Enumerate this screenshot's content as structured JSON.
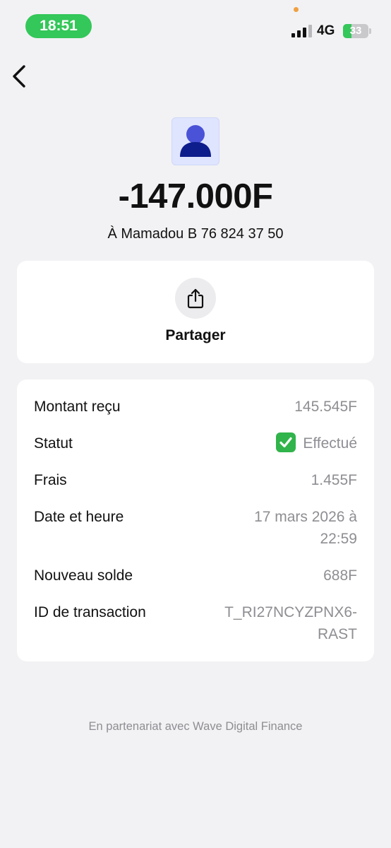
{
  "status_bar": {
    "time": "18:51",
    "network": "4G",
    "battery": "33",
    "battery_level": 0.33,
    "accent": "#34c759"
  },
  "icons": {
    "back": "chevron-left-icon",
    "avatar": "person-icon",
    "share": "share-icon",
    "status": "checkmark-icon"
  },
  "transaction": {
    "amount": "-147.000F",
    "recipient": "À Mamadou B 76 824 37 50"
  },
  "share": {
    "label": "Partager"
  },
  "details": {
    "received_label": "Montant reçu",
    "received_value": "145.545F",
    "status_label": "Statut",
    "status_value": "Effectué",
    "fees_label": "Frais",
    "fees_value": "1.455F",
    "datetime_label": "Date et heure",
    "datetime_value_line1": "17 mars 2026 à",
    "datetime_value_line2": "22:59",
    "balance_label": "Nouveau solde",
    "balance_value": "688F",
    "txid_label": "ID de transaction",
    "txid_value_line1": "T_RI27NCYZPNX6-",
    "txid_value_line2": "RAST"
  },
  "footer": {
    "text": "En partenariat avec Wave Digital Finance"
  }
}
